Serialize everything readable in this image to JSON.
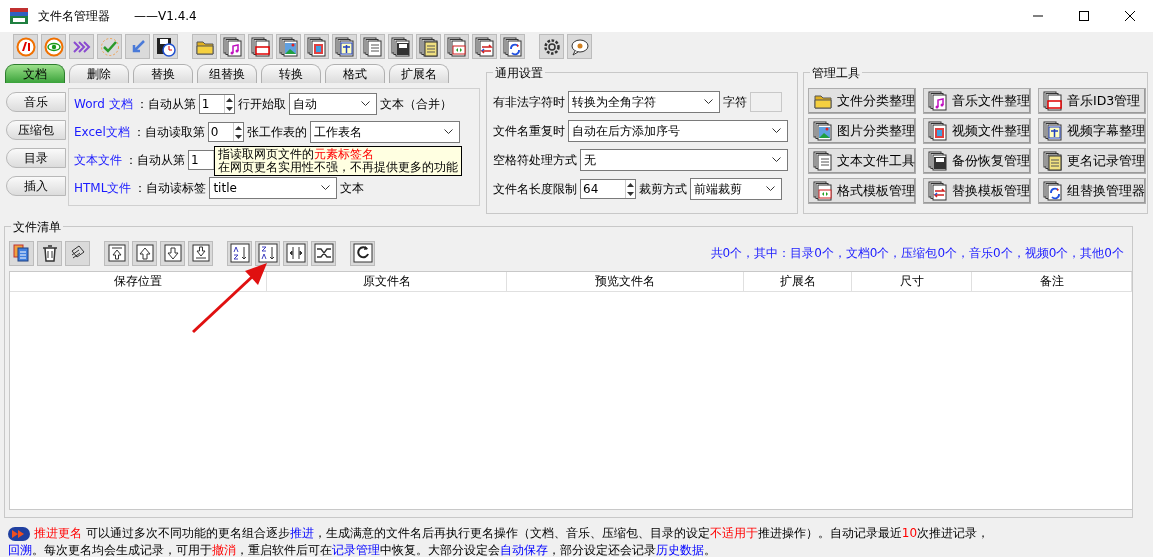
{
  "window": {
    "title": "文件名管理器",
    "version": "——V1.4.4"
  },
  "tabs": [
    {
      "label": "文档",
      "selected": true
    },
    {
      "label": "删除",
      "selected": false
    },
    {
      "label": "替换",
      "selected": false
    },
    {
      "label": "组替换",
      "selected": false
    },
    {
      "label": "转换",
      "selected": false
    },
    {
      "label": "格式",
      "selected": false
    },
    {
      "label": "扩展名",
      "selected": false
    }
  ],
  "side_tabs": [
    {
      "label": "音乐",
      "selected": false
    },
    {
      "label": "压缩包",
      "selected": false
    },
    {
      "label": "目录",
      "selected": false
    },
    {
      "label": "插入",
      "selected": false
    }
  ],
  "document_rows": [
    {
      "kind": "spin-combo",
      "type": "Word 文档",
      "label": "：自动从第",
      "spin": "1",
      "middle": "行开始取",
      "combo": "自动",
      "after": "文本（合并）"
    },
    {
      "kind": "spin-combo",
      "type": "Excel文档",
      "label": "：自动读取第",
      "spin": "0",
      "middle": "张工作表的",
      "combo": "工作表名",
      "after": ""
    },
    {
      "kind": "spin",
      "type": "文本文件",
      "label": "：自动从第",
      "spin": "1"
    },
    {
      "kind": "combo",
      "type": "HTML文件",
      "label": "：自动读标签",
      "combo": "title",
      "after": "文本"
    }
  ],
  "tooltip": {
    "lines": [
      "指读取网页文件的",
      "在网页更名实用性不强，不再提供更多的功能"
    ],
    "highlight": "元素标签名"
  },
  "general_settings": {
    "title": "通用设置",
    "illegal_chars": {
      "label": "有非法字符时",
      "value": "转换为全角字符",
      "char_label": "字符"
    },
    "duplicate": {
      "label": "文件名重复时",
      "value": "自动在后方添加序号"
    },
    "spaces": {
      "label": "空格符处理方式",
      "value": "无"
    },
    "length": {
      "label": "文件名长度限制",
      "value": "64",
      "trim_label": "裁剪方式",
      "trim_value": "前端裁剪"
    }
  },
  "tools": {
    "title": "管理工具",
    "buttons": [
      "文件分类整理",
      "音乐文件整理",
      "音乐ID3管理",
      "图片分类整理",
      "视频文件整理",
      "视频字幕整理",
      "文本文件工具",
      "备份恢复管理",
      "更名记录管理",
      "格式模板管理",
      "替换模板管理",
      "组替换管理器"
    ]
  },
  "file_list": {
    "title": "文件清单",
    "summary": "共0个，其中：目录0个，文档0个，压缩包0个，音乐0个，视频0个，其他0个",
    "columns": [
      "保存位置",
      "原文件名",
      "预览文件名",
      "扩展名",
      "尺寸",
      "备注"
    ]
  },
  "status_bar": {
    "lines": [
      [
        {
          "text": "推进更名",
          "kind": "emphasis"
        },
        {
          "text": " 可以通过多次不同功能的更名组合逐步",
          "kind": "plain"
        },
        {
          "text": "推进",
          "kind": "link"
        },
        {
          "text": "，生成满意的文件名后再执行更名操作（文档、音乐、压缩包、目录的设定",
          "kind": "plain"
        },
        {
          "text": "不适用于",
          "kind": "emphasis"
        },
        {
          "text": "推进操作）。自动记录最近",
          "kind": "plain"
        },
        {
          "text": "10",
          "kind": "emphasis"
        },
        {
          "text": "次推进记录，",
          "kind": "plain"
        }
      ],
      [
        {
          "text": "回溯",
          "kind": "link"
        },
        {
          "text": "。每次更名均会生成记录，可用于",
          "kind": "plain"
        },
        {
          "text": "撤消",
          "kind": "emphasis"
        },
        {
          "text": "，重启软件后可在",
          "kind": "plain"
        },
        {
          "text": "记录管理",
          "kind": "link"
        },
        {
          "text": "中恢复。大部分设定会",
          "kind": "plain"
        },
        {
          "text": "自动保存",
          "kind": "link"
        },
        {
          "text": "，部分设定还会记录",
          "kind": "plain"
        },
        {
          "text": "历史数据",
          "kind": "link"
        },
        {
          "text": "。",
          "kind": "plain"
        }
      ]
    ]
  }
}
